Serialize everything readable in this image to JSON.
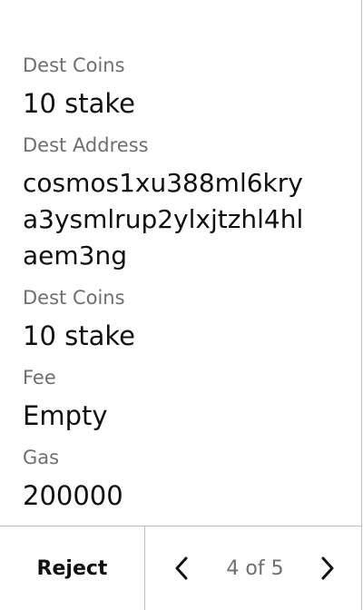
{
  "fields": [
    {
      "label": "Dest Coins",
      "value": "10 stake"
    },
    {
      "label": "Dest Address",
      "value_lines": [
        "cosmos1xu388ml6kry",
        "a3ysmlrup2ylxjtzhl4hl",
        "aem3ng"
      ]
    },
    {
      "label": "Dest Coins",
      "value": "10 stake"
    },
    {
      "label": "Fee",
      "value": "Empty"
    },
    {
      "label": "Gas",
      "value": "200000"
    }
  ],
  "footer": {
    "reject_label": "Reject",
    "page_indicator": "4 of 5",
    "prev_icon": "chevron-left-icon",
    "next_icon": "chevron-right-icon"
  }
}
